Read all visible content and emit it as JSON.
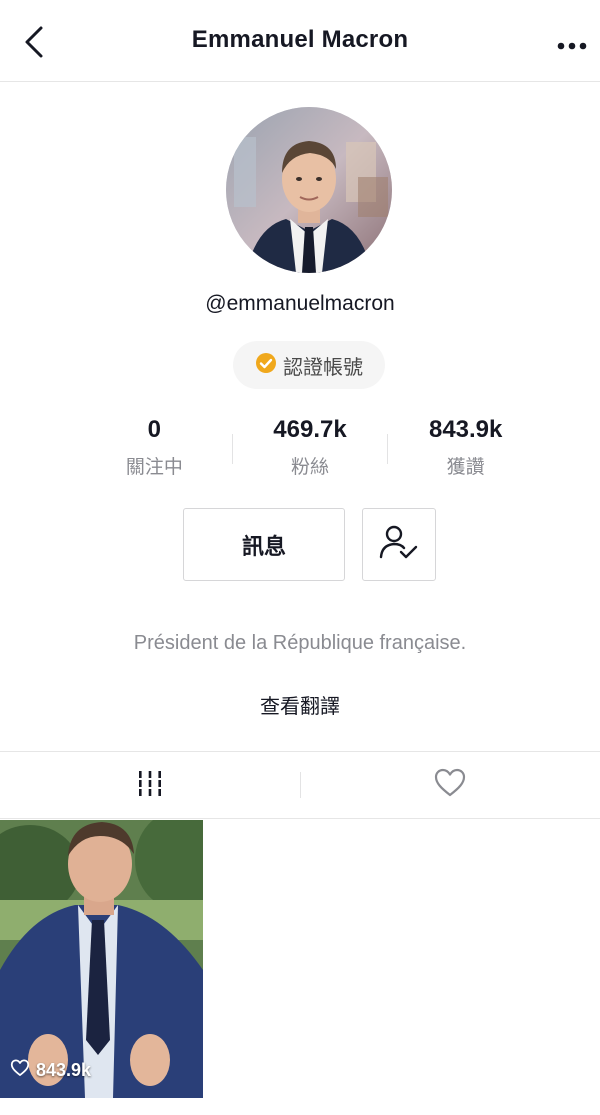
{
  "header": {
    "title": "Emmanuel Macron",
    "back_icon": "chevron-left-icon",
    "more_icon": "more-horizontal-icon"
  },
  "profile": {
    "handle": "@emmanuelmacron",
    "verified_badge": "認證帳號",
    "bio": "Président de la République française.",
    "translate_link": "查看翻譯"
  },
  "stats": {
    "following": {
      "value": "0",
      "label": "關注中"
    },
    "followers": {
      "value": "469.7k",
      "label": "粉絲"
    },
    "likes": {
      "value": "843.9k",
      "label": "獲讚"
    }
  },
  "actions": {
    "message_label": "訊息",
    "follow_icon": "user-check-icon"
  },
  "tabs": [
    {
      "icon": "grid-icon",
      "active": true
    },
    {
      "icon": "heart-outline-icon",
      "active": false
    }
  ],
  "videos": [
    {
      "likes": "843.9k"
    }
  ],
  "colors": {
    "text_primary": "#161823",
    "text_secondary": "#8a8b91",
    "badge_check": "#f0a81c",
    "border": "#e6e6e6"
  }
}
